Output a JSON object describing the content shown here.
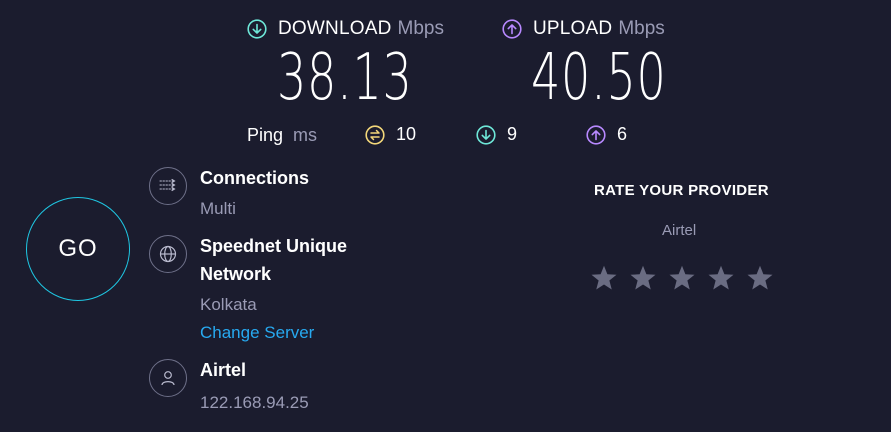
{
  "download": {
    "label": "DOWNLOAD",
    "unit": "Mbps",
    "value": "38.13"
  },
  "upload": {
    "label": "UPLOAD",
    "unit": "Mbps",
    "value": "40.50"
  },
  "ping": {
    "label": "Ping",
    "unit": "ms",
    "idle": "10",
    "down": "9",
    "up": "6"
  },
  "go_label": "GO",
  "connections": {
    "title": "Connections",
    "value": "Multi"
  },
  "server": {
    "title": "Speednet Unique Network",
    "location": "Kolkata",
    "change_label": "Change Server"
  },
  "isp": {
    "name": "Airtel",
    "ip": "122.168.94.25"
  },
  "rating": {
    "title": "RATE YOUR PROVIDER",
    "provider": "Airtel",
    "stars": 5,
    "filled": 0
  },
  "colors": {
    "background": "#1b1c2e",
    "download_accent": "#6ee7d8",
    "upload_accent": "#b889ff",
    "idle_ping": "#f3d77a",
    "go_ring": "#1fc7e3",
    "link": "#27a9f0"
  }
}
